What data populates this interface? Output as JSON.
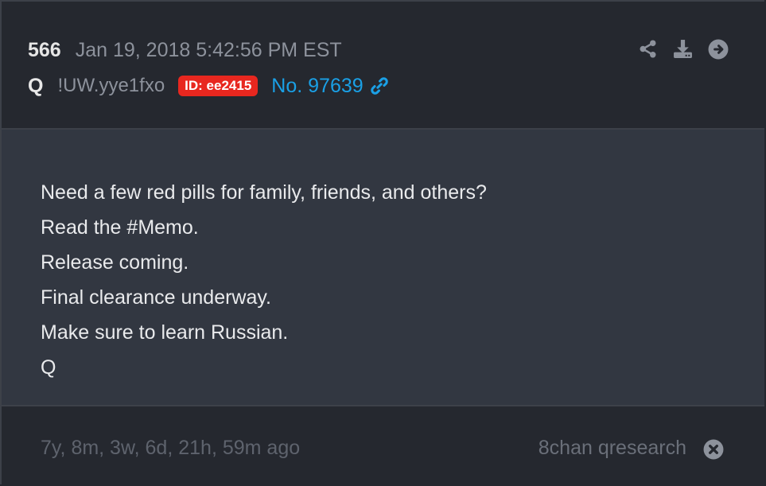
{
  "post": {
    "number": "566",
    "timestamp": "Jan 19, 2018 5:42:56 PM EST",
    "author": "Q",
    "tripcode": "!UW.yye1fxo",
    "id_badge": "ID: ee2415",
    "link_text": "No. 97639",
    "message_lines": [
      "Need a few red pills for family, friends, and others?",
      "Read the #Memo.",
      "Release coming.",
      "Final clearance underway.",
      "Make sure to learn Russian.",
      "Q"
    ],
    "age": "7y, 8m, 3w, 6d, 21h, 59m ago",
    "source": "8chan qresearch"
  },
  "icons": {
    "share": "share-icon",
    "download": "download-icon",
    "go": "arrow-circle-right-icon",
    "link": "link-icon",
    "close": "close-circle-icon"
  },
  "colors": {
    "id_badge_bg": "#e8271f",
    "link": "#1aa0e6",
    "header_bg": "#25282f",
    "body_bg": "#323741"
  }
}
